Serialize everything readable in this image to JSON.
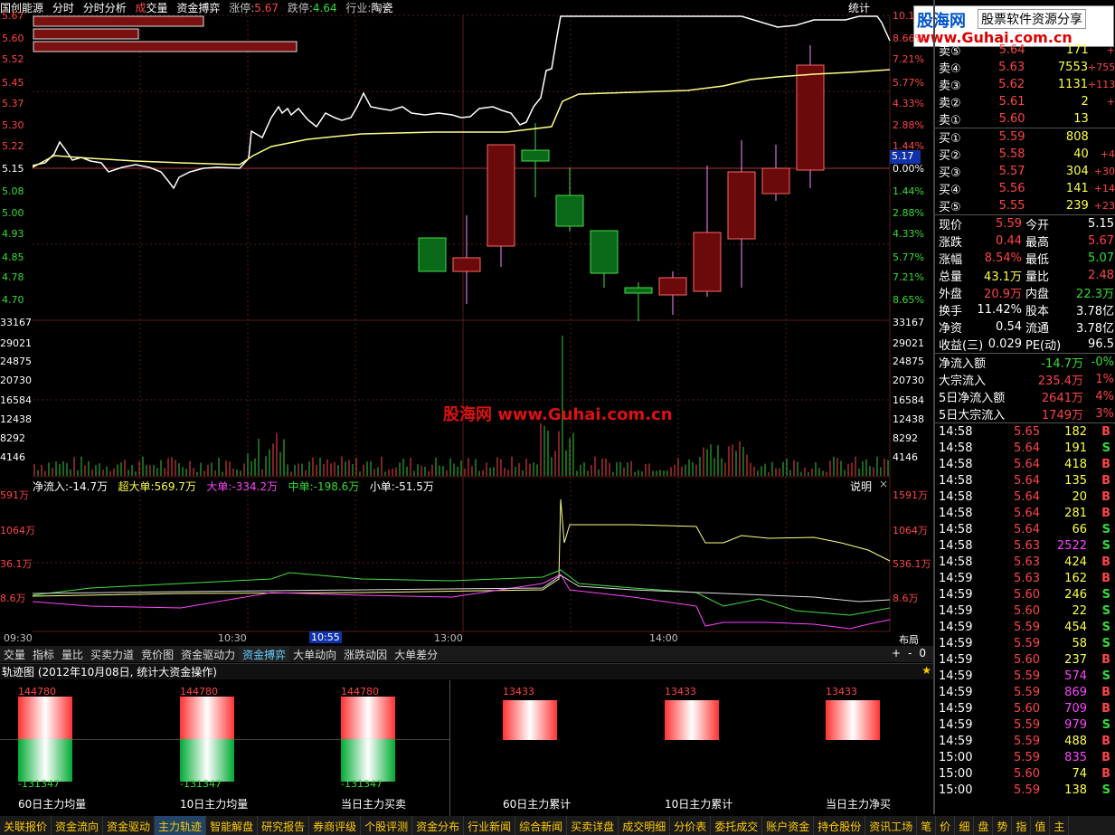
{
  "header": {
    "stock": "国创能源",
    "tab1": "分时",
    "tab2": "分时分析",
    "tab3a": "成",
    "tab3b": "交量",
    "tab4": "资金搏弈",
    "up_label": "涨停:",
    "up_val": "5.67",
    "down_label": "跌停:",
    "down_val": "4.64",
    "ind_label": "行业:",
    "ind_val": "陶瓷",
    "stat": "统计"
  },
  "watermark": {
    "logo_cn": "股海网",
    "logo_sub": "股票软件资源分享",
    "logo_url": "www.Guhai.com.cn",
    "mid": "股海网 www.Guhai.com.cn"
  },
  "price_axis": [
    "5.67",
    "5.60",
    "5.52",
    "5.45",
    "5.37",
    "5.30",
    "5.22",
    "5.15",
    "5.08",
    "5.00",
    "4.93",
    "4.85",
    "4.78",
    "4.70"
  ],
  "pct_axis": [
    "10.1",
    "8.66%",
    "7.21%",
    "5.77%",
    "4.33%",
    "2.88%",
    "1.44%",
    "0.00%",
    "1.44%",
    "2.88%",
    "4.33%",
    "5.77%",
    "7.21%",
    "8.65%"
  ],
  "last_price": "5.17",
  "vol_axis": [
    "33167",
    "29021",
    "24875",
    "20730",
    "16584",
    "12438",
    "8292",
    "4146"
  ],
  "flow": {
    "net": "净流入:-14.7万",
    "super": "超大单:569.7万",
    "big": "大单:-334.2万",
    "mid": "中单:-198.6万",
    "small": "小单:-51.5万",
    "help": "说明"
  },
  "flow_axis_left": [
    "591万",
    "1064万",
    "36.1万",
    "8.6万"
  ],
  "flow_axis_right": [
    "1591万",
    "1064万",
    "536.1万",
    "8.6万"
  ],
  "time_axis": [
    "09:30",
    "10:30",
    "10:55",
    "13:00",
    "14:00"
  ],
  "layout_btn": "布局",
  "tabs": [
    "交量",
    "指标",
    "量比",
    "买卖力道",
    "竞价图",
    "资金驱动力",
    "资金搏弈",
    "大单动向",
    "涨跌动因",
    "大单差分"
  ],
  "tabs_active": "资金搏弈",
  "tab_ctrl": [
    "+",
    "-",
    "0"
  ],
  "track": {
    "title": "轨迹图 (2012年10月08日, 统计大资金操作)",
    "items": [
      {
        "top": "144780",
        "bottom": "-131347",
        "caption": "60日主力均量"
      },
      {
        "top": "144780",
        "bottom": "-131347",
        "caption": "10日主力均量"
      },
      {
        "top": "144780",
        "bottom": "-131347",
        "caption": "当日主力买卖"
      },
      {
        "top": "13433",
        "caption": "60日主力累计"
      },
      {
        "top": "13433",
        "caption": "10日主力累计"
      },
      {
        "top": "13433",
        "caption": "当日主力净买"
      }
    ]
  },
  "orderbook": {
    "sell": [
      {
        "l": "卖⑤",
        "p": "5.64",
        "v": "171",
        "c": "+"
      },
      {
        "l": "卖④",
        "p": "5.63",
        "v": "7553",
        "c": "+755"
      },
      {
        "l": "卖③",
        "p": "5.62",
        "v": "1131",
        "c": "+113"
      },
      {
        "l": "卖②",
        "p": "5.61",
        "v": "2",
        "c": "+"
      },
      {
        "l": "卖①",
        "p": "5.60",
        "v": "13",
        "c": ""
      }
    ],
    "buy": [
      {
        "l": "买①",
        "p": "5.59",
        "v": "808",
        "c": ""
      },
      {
        "l": "买②",
        "p": "5.58",
        "v": "40",
        "c": "+4"
      },
      {
        "l": "买③",
        "p": "5.57",
        "v": "304",
        "c": "+30"
      },
      {
        "l": "买④",
        "p": "5.56",
        "v": "141",
        "c": "+14"
      },
      {
        "l": "买⑤",
        "p": "5.55",
        "v": "239",
        "c": "+23"
      }
    ]
  },
  "quote": [
    {
      "k1": "现价",
      "v1": "5.59",
      "k2": "今开",
      "v2": "5.15",
      "c1": "red",
      "c2": "wht"
    },
    {
      "k1": "涨跌",
      "v1": "0.44",
      "k2": "最高",
      "v2": "5.67",
      "c1": "red",
      "c2": "red"
    },
    {
      "k1": "涨幅",
      "v1": "8.54%",
      "k2": "最低",
      "v2": "5.07",
      "c1": "red",
      "c2": "grn"
    },
    {
      "k1": "总量",
      "v1": "43.1万",
      "k2": "量比",
      "v2": "2.48",
      "c1": "yel",
      "c2": "red"
    },
    {
      "k1": "外盘",
      "v1": "20.9万",
      "k2": "内盘",
      "v2": "22.3万",
      "c1": "red",
      "c2": "grn"
    },
    {
      "k1": "换手",
      "v1": "11.42%",
      "k2": "股本",
      "v2": "3.78亿",
      "c1": "wht",
      "c2": "wht"
    },
    {
      "k1": "净资",
      "v1": "0.54",
      "k2": "流通",
      "v2": "3.78亿",
      "c1": "wht",
      "c2": "wht"
    },
    {
      "k1": "收益(三)",
      "v1": "0.029",
      "k2": "PE(动)",
      "v2": "96.5",
      "c1": "wht",
      "c2": "wht"
    }
  ],
  "fund": [
    {
      "k": "净流入额",
      "v": "-14.7万",
      "p": "-0%",
      "c": "grn"
    },
    {
      "k": "大宗流入",
      "v": "235.4万",
      "p": "1%",
      "c": "red"
    },
    {
      "k": "5日净流入额",
      "v": "2641万",
      "p": "4%",
      "c": "red"
    },
    {
      "k": "5日大宗流入",
      "v": "1749万",
      "p": "3%",
      "c": "red"
    }
  ],
  "ticks": [
    [
      "14:58",
      "5.65",
      "182",
      "B"
    ],
    [
      "14:58",
      "5.64",
      "191",
      "S"
    ],
    [
      "14:58",
      "5.64",
      "418",
      "B"
    ],
    [
      "14:58",
      "5.64",
      "135",
      "B"
    ],
    [
      "14:58",
      "5.64",
      "20",
      "B"
    ],
    [
      "14:58",
      "5.64",
      "281",
      "B"
    ],
    [
      "14:58",
      "5.64",
      "66",
      "S"
    ],
    [
      "14:58",
      "5.63",
      "2522",
      "S"
    ],
    [
      "14:58",
      "5.63",
      "424",
      "B"
    ],
    [
      "14:59",
      "5.63",
      "162",
      "B"
    ],
    [
      "14:59",
      "5.60",
      "246",
      "S"
    ],
    [
      "14:59",
      "5.60",
      "22",
      "S"
    ],
    [
      "14:59",
      "5.59",
      "454",
      "S"
    ],
    [
      "14:59",
      "5.59",
      "58",
      "S"
    ],
    [
      "14:59",
      "5.60",
      "237",
      "B"
    ],
    [
      "14:59",
      "5.59",
      "574",
      "S"
    ],
    [
      "14:59",
      "5.59",
      "869",
      "B"
    ],
    [
      "14:59",
      "5.60",
      "709",
      "B"
    ],
    [
      "14:59",
      "5.59",
      "979",
      "S"
    ],
    [
      "14:59",
      "5.59",
      "488",
      "B"
    ],
    [
      "15:00",
      "5.59",
      "835",
      "B"
    ],
    [
      "15:00",
      "5.60",
      "74",
      "B"
    ],
    [
      "15:00",
      "5.59",
      "138",
      "S"
    ]
  ],
  "bottom_tabs": [
    "关联报价",
    "资金流向",
    "资金驱动",
    "主力轨迹",
    "智能解盘",
    "研究报告",
    "券商评级",
    "个股评测",
    "资金分布",
    "行业新闻",
    "综合新闻",
    "买卖详盘",
    "成交明细",
    "分价表",
    "委托成交",
    "账户资金",
    "持仓股份",
    "资讯工场",
    "笔",
    "价",
    "细",
    "盘",
    "势",
    "指",
    "值",
    "主"
  ]
}
